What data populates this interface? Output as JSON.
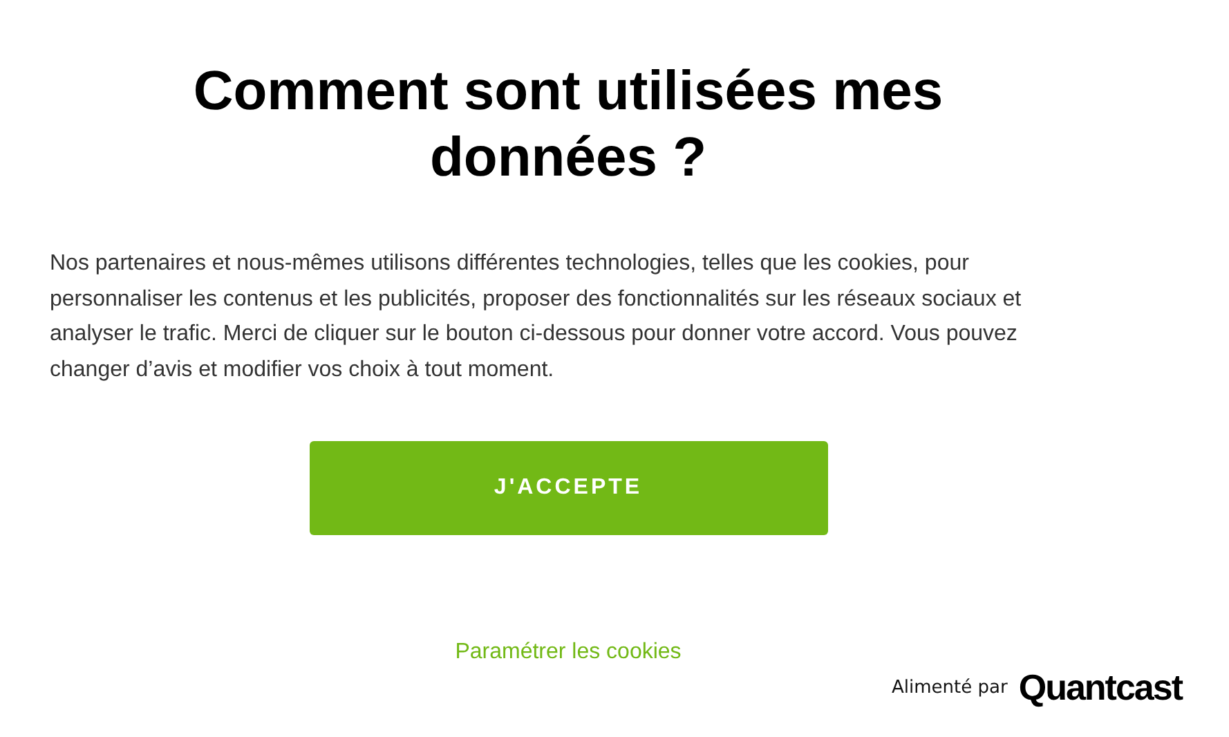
{
  "title": "Comment sont utilisées mes données ?",
  "body": "Nos partenaires et nous-mêmes utilisons différentes technologies, telles que les cookies, pour personnaliser les contenus et les publicités, proposer des fonctionnalités sur les réseaux sociaux et analyser le trafic. Merci de cliquer sur le bouton ci-dessous pour donner votre accord. Vous pouvez changer d’avis et modifier vos choix à tout moment.",
  "accept_button": "J'ACCEPTE",
  "settings_link": "Paramétrer les cookies",
  "footer": {
    "powered_by": "Alimenté par",
    "brand": "Quantcast"
  }
}
